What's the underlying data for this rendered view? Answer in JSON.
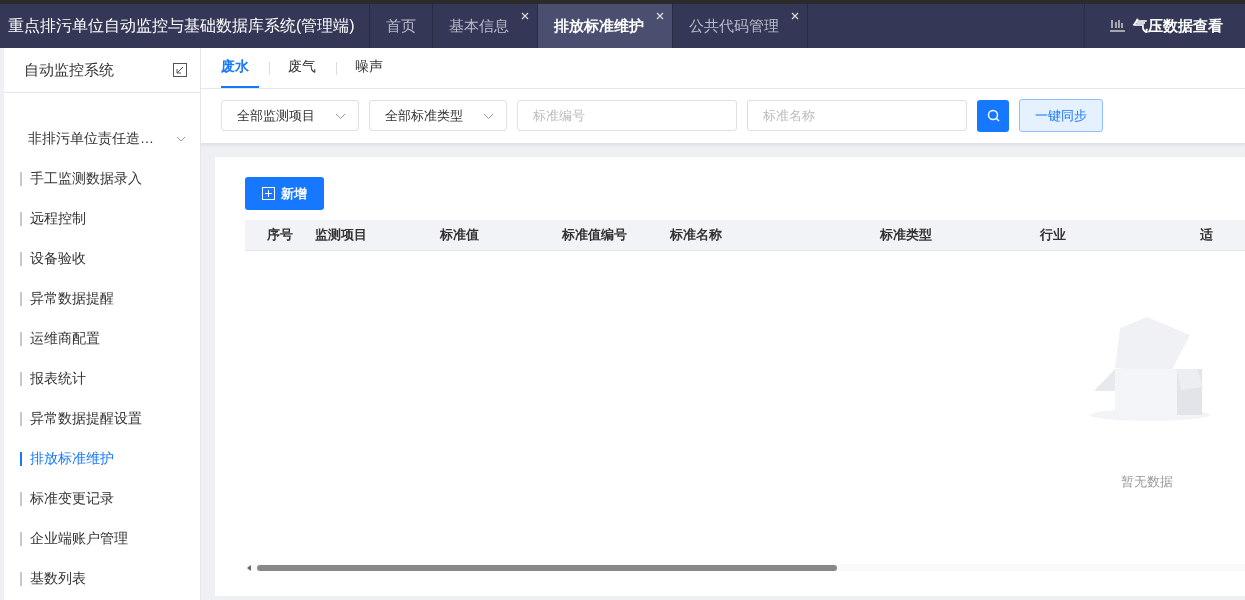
{
  "app_title": "重点排污单位自动监控与基础数据库系统(管理端)",
  "tabs": [
    {
      "label": "首页",
      "selected": false,
      "closable": false
    },
    {
      "label": "基本信息",
      "selected": false,
      "closable": true
    },
    {
      "label": "排放标准维护",
      "selected": true,
      "closable": true
    },
    {
      "label": "公共代码管理",
      "selected": false,
      "closable": true
    }
  ],
  "header_link": "气压数据查看",
  "sidebar": {
    "title": "自动监控系统",
    "items": [
      {
        "label": "非排污单位责任造…",
        "kind": "group",
        "selected": false
      },
      {
        "label": "手工监测数据录入",
        "kind": "item",
        "selected": false
      },
      {
        "label": "远程控制",
        "kind": "item",
        "selected": false
      },
      {
        "label": "设备验收",
        "kind": "item",
        "selected": false
      },
      {
        "label": "异常数据提醒",
        "kind": "item",
        "selected": false
      },
      {
        "label": "运维商配置",
        "kind": "item",
        "selected": false
      },
      {
        "label": "报表统计",
        "kind": "item",
        "selected": false
      },
      {
        "label": "异常数据提醒设置",
        "kind": "item",
        "selected": false
      },
      {
        "label": "排放标准维护",
        "kind": "item",
        "selected": true
      },
      {
        "label": "标准变更记录",
        "kind": "item",
        "selected": false
      },
      {
        "label": "企业端账户管理",
        "kind": "item",
        "selected": false
      },
      {
        "label": "基数列表",
        "kind": "item",
        "selected": false
      }
    ]
  },
  "subtabs": [
    {
      "label": "废水",
      "selected": true
    },
    {
      "label": "废气",
      "selected": false
    },
    {
      "label": "噪声",
      "selected": false
    }
  ],
  "filters": {
    "item_select": "全部监测项目",
    "type_select": "全部标准类型",
    "code_placeholder": "标准编号",
    "name_placeholder": "标准名称",
    "sync_button": "一键同步"
  },
  "add_button": "新增",
  "table": {
    "columns": [
      "序号",
      "监测项目",
      "标准值",
      "标准值编号",
      "标准名称",
      "标准类型",
      "行业",
      "适"
    ],
    "empty_text": "暂无数据"
  }
}
